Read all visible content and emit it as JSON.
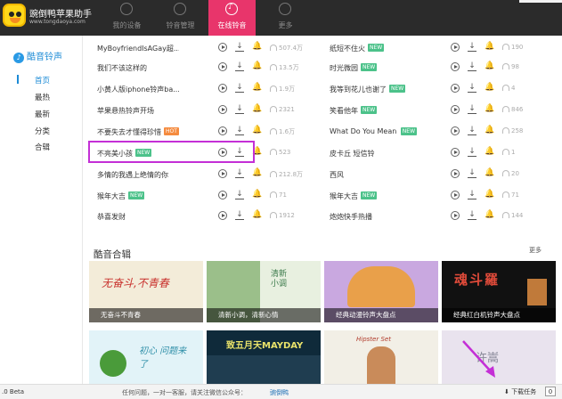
{
  "app": {
    "title": "豌倒鸭苹果助手",
    "subtitle": "www.tongdaoya.com"
  },
  "nav": [
    {
      "label": "我的设备",
      "active": false
    },
    {
      "label": "铃音管理",
      "active": false
    },
    {
      "label": "在线铃音",
      "active": true
    },
    {
      "label": "更多",
      "active": false
    }
  ],
  "sidebar": {
    "heading": "酷音铃声",
    "items": [
      {
        "label": "首页",
        "active": true
      },
      {
        "label": "最热",
        "active": false
      },
      {
        "label": "最新",
        "active": false
      },
      {
        "label": "分类",
        "active": false
      },
      {
        "label": "合辑",
        "active": false
      }
    ]
  },
  "songs_left": [
    {
      "name": "MyBoyfriendIsAGay超...",
      "badge": "",
      "count": "507.4万"
    },
    {
      "name": "我们不该这样的",
      "badge": "",
      "count": "13.5万"
    },
    {
      "name": "小黄人版iphone铃声ba...",
      "badge": "",
      "count": "1.9万"
    },
    {
      "name": "苹果悬热铃声开场",
      "badge": "",
      "count": "2321"
    },
    {
      "name": "不要失去才懂得珍惜",
      "badge": "HOT",
      "count": "1.6万"
    },
    {
      "name": "不亮美小孩",
      "badge": "NEW",
      "count": "523"
    },
    {
      "name": "多情的我遇上绝情的你",
      "badge": "",
      "count": "212.8万"
    },
    {
      "name": "猴年大吉",
      "badge": "NEW",
      "count": "71"
    },
    {
      "name": "恭喜发财",
      "badge": "",
      "count": "1912"
    }
  ],
  "songs_right": [
    {
      "name": "纸短不住火",
      "badge": "NEW",
      "count": "190"
    },
    {
      "name": "时光微园",
      "badge": "NEW",
      "count": "98"
    },
    {
      "name": "我等到花儿也谢了",
      "badge": "NEW",
      "count": "4"
    },
    {
      "name": "笑看他年",
      "badge": "NEW",
      "count": "846"
    },
    {
      "name": "What Do You Mean",
      "badge": "NEW",
      "count": "258"
    },
    {
      "name": "皮卡丘 短信铃",
      "badge": "",
      "count": "1"
    },
    {
      "name": "西风",
      "badge": "",
      "count": "20"
    },
    {
      "name": "猴年大吉",
      "badge": "NEW",
      "count": "71"
    },
    {
      "name": "炮炮快手热播",
      "badge": "",
      "count": "144"
    }
  ],
  "albums": {
    "title": "酷音合辑",
    "more": "更多",
    "items": [
      {
        "caption": "无奋斗不青春",
        "art": "无奋斗,不青春"
      },
      {
        "caption": "清新小调，清新心情",
        "art": "清新小调"
      },
      {
        "caption": "经典动漫铃声大盘点",
        "art": ""
      },
      {
        "caption": "经典红白机铃声大盘点",
        "art": "魂斗羅"
      },
      {
        "caption": "",
        "art": "初心 问题来了"
      },
      {
        "caption": "",
        "art": "致五月天MAYDAY"
      },
      {
        "caption": "",
        "art": "Hipster Set"
      },
      {
        "caption": "",
        "art": "许嵩"
      }
    ]
  },
  "status": {
    "version": ".0 Beta",
    "notice": "任何问题，一对一客服，请关注微信公众号：",
    "notice_link": "豌倒鸭",
    "download_label": "下载任务",
    "download_count": "0"
  },
  "colors": {
    "accent": "#e8356b",
    "blue": "#1c8bd6",
    "highlight": "#c42fd6"
  }
}
